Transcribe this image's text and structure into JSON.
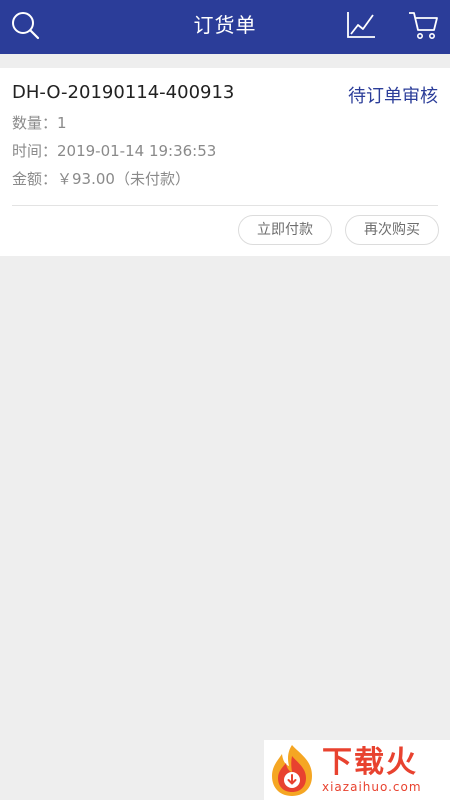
{
  "header": {
    "title": "订货单",
    "icons": [
      "search-icon",
      "chart-icon",
      "cart-icon"
    ],
    "background": "#2b3d99"
  },
  "order": {
    "number": "DH-O-20190114-400913",
    "status": "待订单审核",
    "quantity": "数量：1",
    "time": "时间：2019-01-14 19:36:53",
    "amount": "金额：￥93.00（未付款）",
    "actions": {
      "pay_label": "立即付款",
      "rebuy_label": "再次购买"
    }
  },
  "watermark": {
    "name": "下载火",
    "domain": "xiazaihuo.com"
  },
  "colors": {
    "accent": "#2b3d99",
    "background": "#eeeeee",
    "watermark": "#e8422f"
  }
}
